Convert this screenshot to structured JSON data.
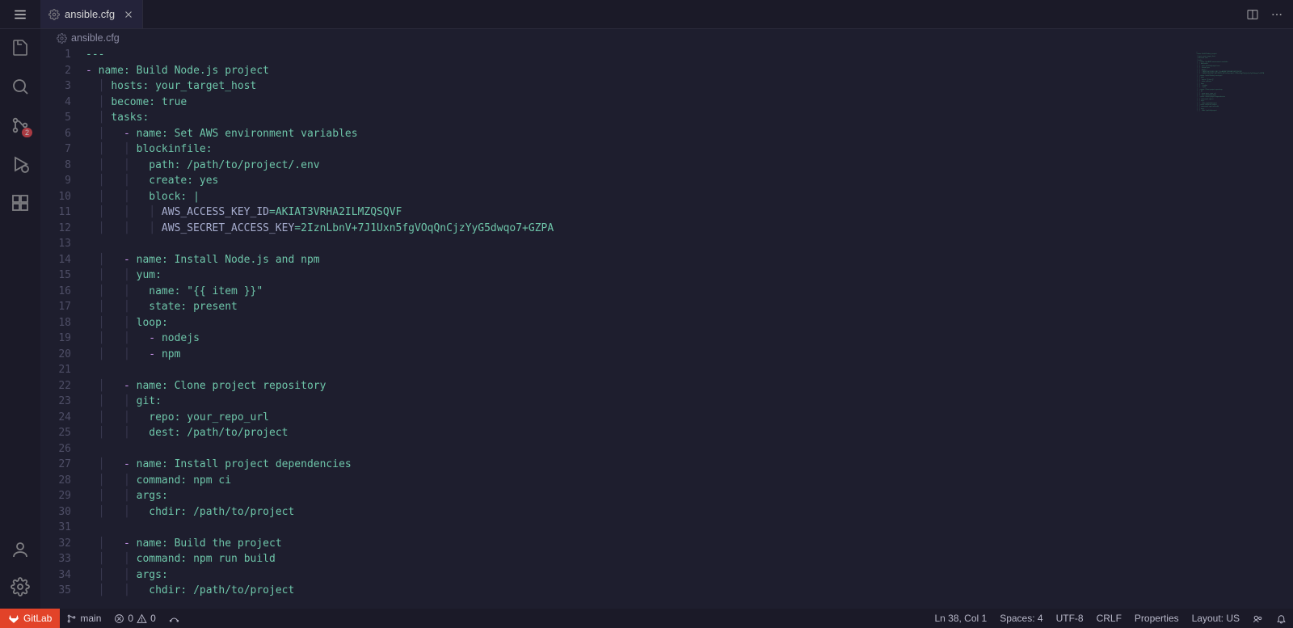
{
  "tab": {
    "name": "ansible.cfg"
  },
  "breadcrumb": {
    "name": "ansible.cfg"
  },
  "scm_badge": "2",
  "statusbar": {
    "gitlab": "GitLab",
    "branch": "main",
    "errors": "0",
    "warnings": "0",
    "cursor": "Ln 38, Col 1",
    "spaces": "Spaces: 4",
    "encoding": "UTF-8",
    "eol": "CRLF",
    "mode": "Properties",
    "layout": "Layout: US"
  },
  "code_lines": [
    {
      "n": "1",
      "seg": [
        {
          "c": "plain",
          "t": "---"
        }
      ]
    },
    {
      "n": "2",
      "seg": [
        {
          "c": "dash",
          "t": "- "
        },
        {
          "c": "key",
          "t": "name"
        },
        {
          "c": "plain",
          "t": ": "
        },
        {
          "c": "str",
          "t": "Build Node.js project"
        }
      ]
    },
    {
      "n": "3",
      "seg": [
        {
          "c": "guide",
          "t": "  │ "
        },
        {
          "c": "key",
          "t": "hosts"
        },
        {
          "c": "plain",
          "t": ": "
        },
        {
          "c": "str",
          "t": "your_target_host"
        }
      ]
    },
    {
      "n": "4",
      "seg": [
        {
          "c": "guide",
          "t": "  │ "
        },
        {
          "c": "key",
          "t": "become"
        },
        {
          "c": "plain",
          "t": ": "
        },
        {
          "c": "str",
          "t": "true"
        }
      ]
    },
    {
      "n": "5",
      "seg": [
        {
          "c": "guide",
          "t": "  │ "
        },
        {
          "c": "key",
          "t": "tasks"
        },
        {
          "c": "plain",
          "t": ":"
        }
      ]
    },
    {
      "n": "6",
      "seg": [
        {
          "c": "guide",
          "t": "  │   "
        },
        {
          "c": "dash",
          "t": "- "
        },
        {
          "c": "key",
          "t": "name"
        },
        {
          "c": "plain",
          "t": ": "
        },
        {
          "c": "str",
          "t": "Set AWS environment variables"
        }
      ]
    },
    {
      "n": "7",
      "seg": [
        {
          "c": "guide",
          "t": "  │   │ "
        },
        {
          "c": "key",
          "t": "blockinfile"
        },
        {
          "c": "plain",
          "t": ":"
        }
      ]
    },
    {
      "n": "8",
      "seg": [
        {
          "c": "guide",
          "t": "  │   │   "
        },
        {
          "c": "key",
          "t": "path"
        },
        {
          "c": "plain",
          "t": ": "
        },
        {
          "c": "str",
          "t": "/path/to/project/.env"
        }
      ]
    },
    {
      "n": "9",
      "seg": [
        {
          "c": "guide",
          "t": "  │   │   "
        },
        {
          "c": "key",
          "t": "create"
        },
        {
          "c": "plain",
          "t": ": "
        },
        {
          "c": "str",
          "t": "yes"
        }
      ]
    },
    {
      "n": "10",
      "seg": [
        {
          "c": "guide",
          "t": "  │   │   "
        },
        {
          "c": "key",
          "t": "block"
        },
        {
          "c": "plain",
          "t": ": |"
        }
      ]
    },
    {
      "n": "11",
      "seg": [
        {
          "c": "guide",
          "t": "  │   │   │ "
        },
        {
          "c": "varname",
          "t": "AWS_ACCESS_KEY_ID"
        },
        {
          "c": "plain",
          "t": "="
        },
        {
          "c": "val",
          "t": "AKIAT3VRHA2ILMZQSQVF"
        }
      ]
    },
    {
      "n": "12",
      "seg": [
        {
          "c": "guide",
          "t": "  │   │   │ "
        },
        {
          "c": "varname",
          "t": "AWS_SECRET_ACCESS_KEY"
        },
        {
          "c": "plain",
          "t": "="
        },
        {
          "c": "val",
          "t": "2IznLbnV+7J1Uxn5fgVOqQnCjzYyG5dwqo7+GZPA"
        }
      ]
    },
    {
      "n": "13",
      "seg": [
        {
          "c": "plain",
          "t": ""
        }
      ]
    },
    {
      "n": "14",
      "seg": [
        {
          "c": "guide",
          "t": "  │   "
        },
        {
          "c": "dash",
          "t": "- "
        },
        {
          "c": "key",
          "t": "name"
        },
        {
          "c": "plain",
          "t": ": "
        },
        {
          "c": "str",
          "t": "Install Node.js and npm"
        }
      ]
    },
    {
      "n": "15",
      "seg": [
        {
          "c": "guide",
          "t": "  │   │ "
        },
        {
          "c": "key",
          "t": "yum"
        },
        {
          "c": "plain",
          "t": ":"
        }
      ]
    },
    {
      "n": "16",
      "seg": [
        {
          "c": "guide",
          "t": "  │   │   "
        },
        {
          "c": "key",
          "t": "name"
        },
        {
          "c": "plain",
          "t": ": "
        },
        {
          "c": "str",
          "t": "\"{{ item }}\""
        }
      ]
    },
    {
      "n": "17",
      "seg": [
        {
          "c": "guide",
          "t": "  │   │   "
        },
        {
          "c": "key",
          "t": "state"
        },
        {
          "c": "plain",
          "t": ": "
        },
        {
          "c": "str",
          "t": "present"
        }
      ]
    },
    {
      "n": "18",
      "seg": [
        {
          "c": "guide",
          "t": "  │   │ "
        },
        {
          "c": "key",
          "t": "loop"
        },
        {
          "c": "plain",
          "t": ":"
        }
      ]
    },
    {
      "n": "19",
      "seg": [
        {
          "c": "guide",
          "t": "  │   │   "
        },
        {
          "c": "dash",
          "t": "- "
        },
        {
          "c": "str",
          "t": "nodejs"
        }
      ]
    },
    {
      "n": "20",
      "seg": [
        {
          "c": "guide",
          "t": "  │   │   "
        },
        {
          "c": "dash",
          "t": "- "
        },
        {
          "c": "str",
          "t": "npm"
        }
      ]
    },
    {
      "n": "21",
      "seg": [
        {
          "c": "plain",
          "t": ""
        }
      ]
    },
    {
      "n": "22",
      "seg": [
        {
          "c": "guide",
          "t": "  │   "
        },
        {
          "c": "dash",
          "t": "- "
        },
        {
          "c": "key",
          "t": "name"
        },
        {
          "c": "plain",
          "t": ": "
        },
        {
          "c": "str",
          "t": "Clone project repository"
        }
      ]
    },
    {
      "n": "23",
      "seg": [
        {
          "c": "guide",
          "t": "  │   │ "
        },
        {
          "c": "key",
          "t": "git"
        },
        {
          "c": "plain",
          "t": ":"
        }
      ]
    },
    {
      "n": "24",
      "seg": [
        {
          "c": "guide",
          "t": "  │   │   "
        },
        {
          "c": "key",
          "t": "repo"
        },
        {
          "c": "plain",
          "t": ": "
        },
        {
          "c": "str",
          "t": "your_repo_url"
        }
      ]
    },
    {
      "n": "25",
      "seg": [
        {
          "c": "guide",
          "t": "  │   │   "
        },
        {
          "c": "key",
          "t": "dest"
        },
        {
          "c": "plain",
          "t": ": "
        },
        {
          "c": "str",
          "t": "/path/to/project"
        }
      ]
    },
    {
      "n": "26",
      "seg": [
        {
          "c": "plain",
          "t": ""
        }
      ]
    },
    {
      "n": "27",
      "seg": [
        {
          "c": "guide",
          "t": "  │   "
        },
        {
          "c": "dash",
          "t": "- "
        },
        {
          "c": "key",
          "t": "name"
        },
        {
          "c": "plain",
          "t": ": "
        },
        {
          "c": "str",
          "t": "Install project dependencies"
        }
      ]
    },
    {
      "n": "28",
      "seg": [
        {
          "c": "guide",
          "t": "  │   │ "
        },
        {
          "c": "key",
          "t": "command"
        },
        {
          "c": "plain",
          "t": ": "
        },
        {
          "c": "str",
          "t": "npm ci"
        }
      ]
    },
    {
      "n": "29",
      "seg": [
        {
          "c": "guide",
          "t": "  │   │ "
        },
        {
          "c": "key",
          "t": "args"
        },
        {
          "c": "plain",
          "t": ":"
        }
      ]
    },
    {
      "n": "30",
      "seg": [
        {
          "c": "guide",
          "t": "  │   │   "
        },
        {
          "c": "key",
          "t": "chdir"
        },
        {
          "c": "plain",
          "t": ": "
        },
        {
          "c": "str",
          "t": "/path/to/project"
        }
      ]
    },
    {
      "n": "31",
      "seg": [
        {
          "c": "plain",
          "t": ""
        }
      ]
    },
    {
      "n": "32",
      "seg": [
        {
          "c": "guide",
          "t": "  │   "
        },
        {
          "c": "dash",
          "t": "- "
        },
        {
          "c": "key",
          "t": "name"
        },
        {
          "c": "plain",
          "t": ": "
        },
        {
          "c": "str",
          "t": "Build the project"
        }
      ]
    },
    {
      "n": "33",
      "seg": [
        {
          "c": "guide",
          "t": "  │   │ "
        },
        {
          "c": "key",
          "t": "command"
        },
        {
          "c": "plain",
          "t": ": "
        },
        {
          "c": "str",
          "t": "npm run build"
        }
      ]
    },
    {
      "n": "34",
      "seg": [
        {
          "c": "guide",
          "t": "  │   │ "
        },
        {
          "c": "key",
          "t": "args"
        },
        {
          "c": "plain",
          "t": ":"
        }
      ]
    },
    {
      "n": "35",
      "seg": [
        {
          "c": "guide",
          "t": "  │   │   "
        },
        {
          "c": "key",
          "t": "chdir"
        },
        {
          "c": "plain",
          "t": ": "
        },
        {
          "c": "str",
          "t": "/path/to/project"
        }
      ]
    }
  ]
}
